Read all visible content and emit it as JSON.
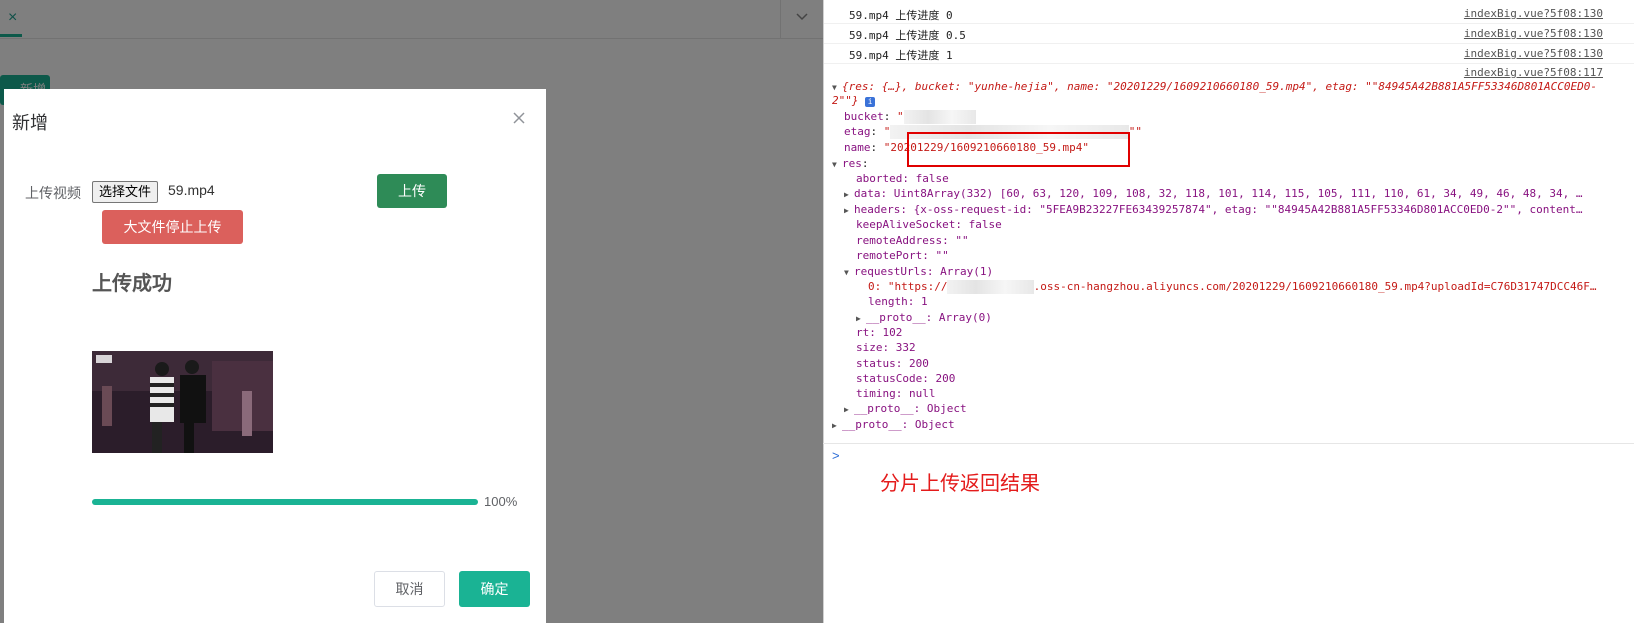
{
  "app": {
    "tab_close_icon": "×",
    "add_button_label": "新增"
  },
  "dialog": {
    "title": "新增",
    "close_icon": "close-icon",
    "upload_label": "上传视频",
    "choose_file_label": "选择文件",
    "file_name": "59.mp4",
    "upload_button": "上传",
    "stop_button": "大文件停止上传",
    "success_text": "上传成功",
    "progress_value": 1.0,
    "progress_text": "100%",
    "cancel_button": "取消",
    "confirm_button": "确定",
    "accent_color": "#1ab394"
  },
  "console": {
    "logs": [
      {
        "text": "59.mp4 上传进度 0",
        "source": "indexBig.vue?5f08:130"
      },
      {
        "text": "59.mp4 上传进度 0.5",
        "source": "indexBig.vue?5f08:130"
      },
      {
        "text": "59.mp4 上传进度 1",
        "source": "indexBig.vue?5f08:130"
      }
    ],
    "object_source": "indexBig.vue?5f08:117",
    "summary_line1": "{res: {…}, bucket: \"yunhe-hejia\", name: \"20201229/1609210660180_59.mp4\", etag: \"\"84945A42B881A5FF53346D801ACC0ED0-",
    "summary_line2": "2\"\"}",
    "bucket_key": "bucket",
    "etag_key": "etag",
    "name_key": "name",
    "name_value": "\"20201229/1609210660180_59.mp4\"",
    "res_key": "res",
    "aborted": "aborted: false",
    "data_line": "data: Uint8Array(332) [60, 63, 120, 109, 108, 32, 118, 101, 114, 115, 105, 111, 110, 61, 34, 49, 46, 48, 34, …",
    "headers_line": "headers: {x-oss-request-id: \"5FEA9B23227FE63439257874\", etag: \"\"84945A42B881A5FF53346D801ACC0ED0-2\"\", content…",
    "keepalive": "keepAliveSocket: false",
    "remote_address": "remoteAddress: \"\"",
    "remote_port": "remotePort: \"\"",
    "request_urls": "requestUrls: Array(1)",
    "url_line_prefix": "0: \"https://",
    "url_line_suffix": ".oss-cn-hangzhou.aliyuncs.com/20201229/1609210660180_59.mp4?uploadId=C76D31747DCC46F…",
    "length_line": "length: 1",
    "proto_array": "__proto__: Array(0)",
    "rt_line": "rt: 102",
    "size_line": "size: 332",
    "status_line": "status: 200",
    "status_code_line": "statusCode: 200",
    "timing_line": "timing: null",
    "proto_object_inner": "__proto__: Object",
    "proto_object_outer": "__proto__: Object",
    "prompt": ">"
  },
  "annotation": "分片上传返回结果",
  "annotation_color": "#e41b1b"
}
